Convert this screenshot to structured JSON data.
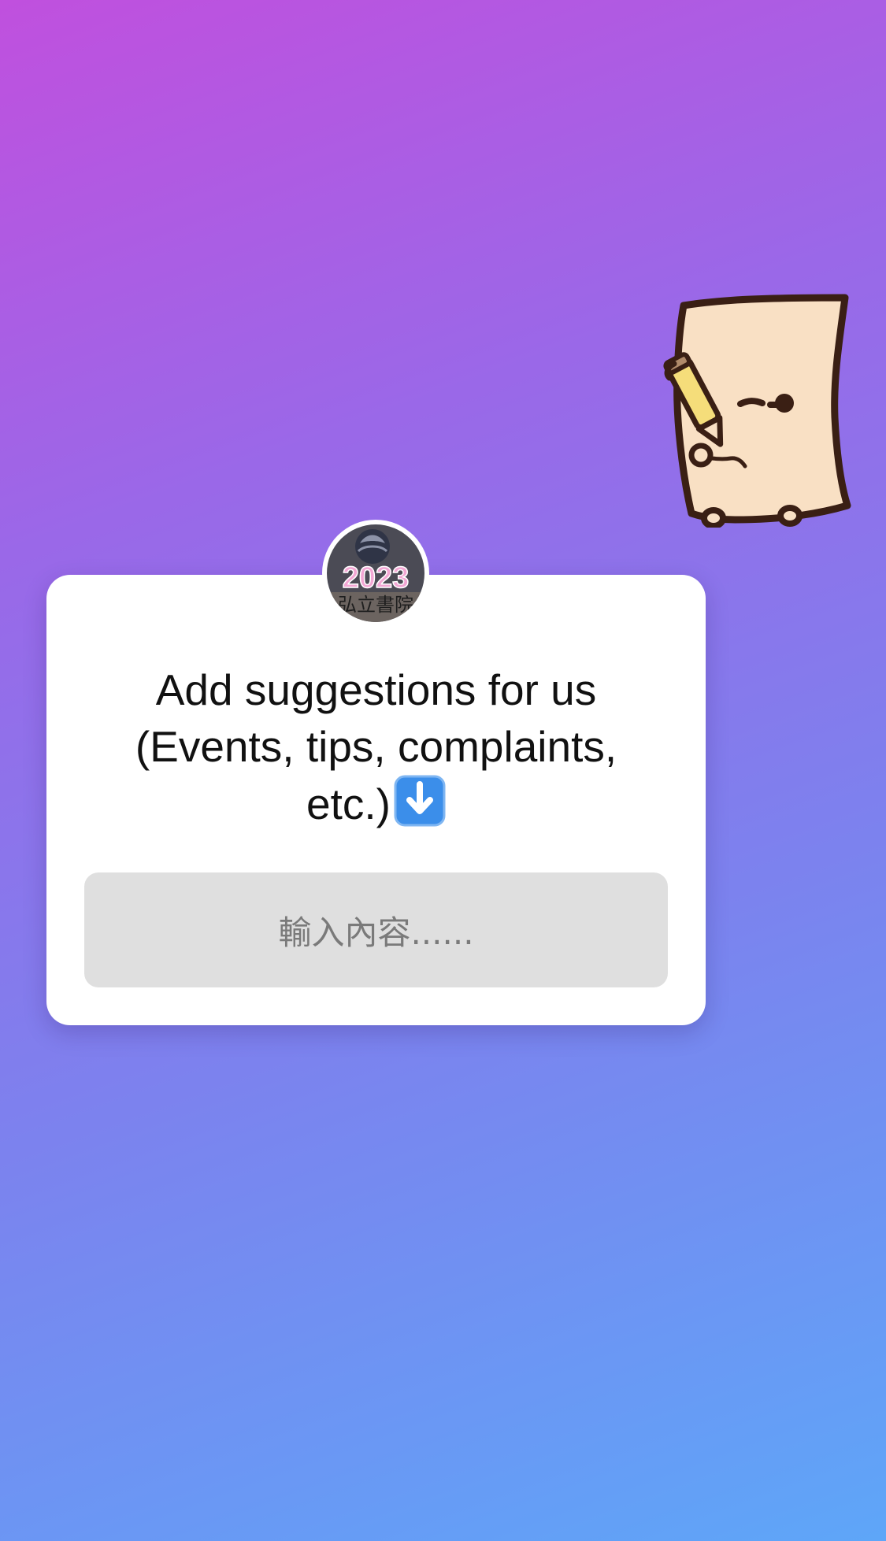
{
  "question_sticker": {
    "prompt": "Add suggestions for us (Events, tips, complaints, etc.)",
    "prompt_emoji": "down-arrow-emoji",
    "input_placeholder": "輸入內容......"
  },
  "avatar": {
    "year_text": "2023",
    "name_text": "弘立書院"
  },
  "sticker": {
    "icon": "writing-paper-character-sticker"
  },
  "colors": {
    "gradient_top_left": "#c050de",
    "gradient_bottom_right": "#5ea6f8",
    "card": "#ffffff",
    "input_bg": "#dfdfdf",
    "placeholder": "#7a7a7a",
    "emoji_blue": "#3b8eea"
  }
}
